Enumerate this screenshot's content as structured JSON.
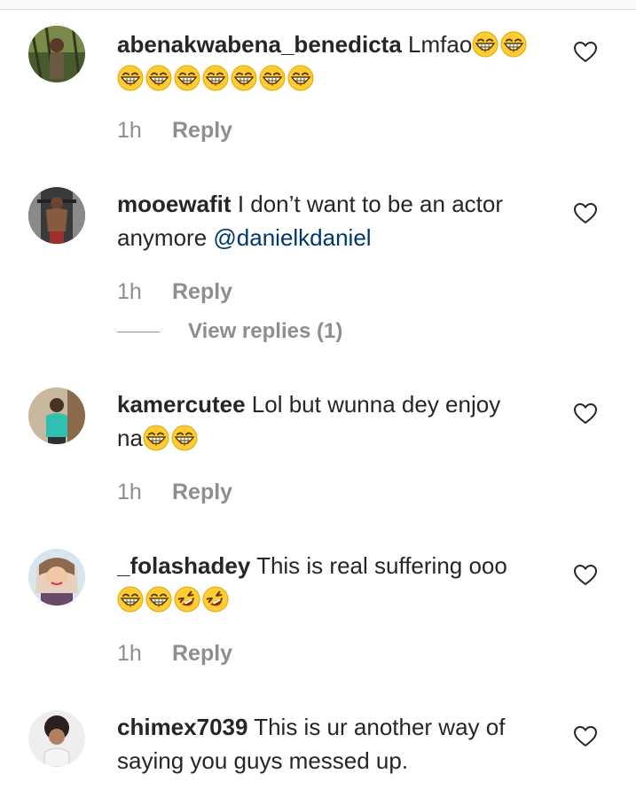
{
  "comments": [
    {
      "username": "abenakwabena_benedicta",
      "text": "Lmfao",
      "emojis_line1": 2,
      "emojis_line2": 7,
      "time": "1h",
      "reply_label": "Reply"
    },
    {
      "username": "mooewafit",
      "text": "I don’t want to be an actor anymore",
      "mention": "@danielkdaniel",
      "time": "1h",
      "reply_label": "Reply",
      "view_replies_label": "View replies (1)"
    },
    {
      "username": "kamercutee",
      "text_line1": "Lol but wunna dey enjoy",
      "text_line2": "na",
      "time": "1h",
      "reply_label": "Reply"
    },
    {
      "username": "_folashadey",
      "text": "This is real suffering ooo",
      "time": "1h",
      "reply_label": "Reply"
    },
    {
      "username": "chimex7039",
      "text": "This is ur another way of saying you guys messed up."
    }
  ],
  "icons": {
    "heart": "heart-outline-icon",
    "grin": "grinning-squinting-face-emoji",
    "rofl": "rolling-on-floor-laughing-emoji"
  },
  "colors": {
    "text": "#262626",
    "muted": "#8e8e8e",
    "mention": "#00376b",
    "emoji_yellow": "#ffcc33"
  }
}
